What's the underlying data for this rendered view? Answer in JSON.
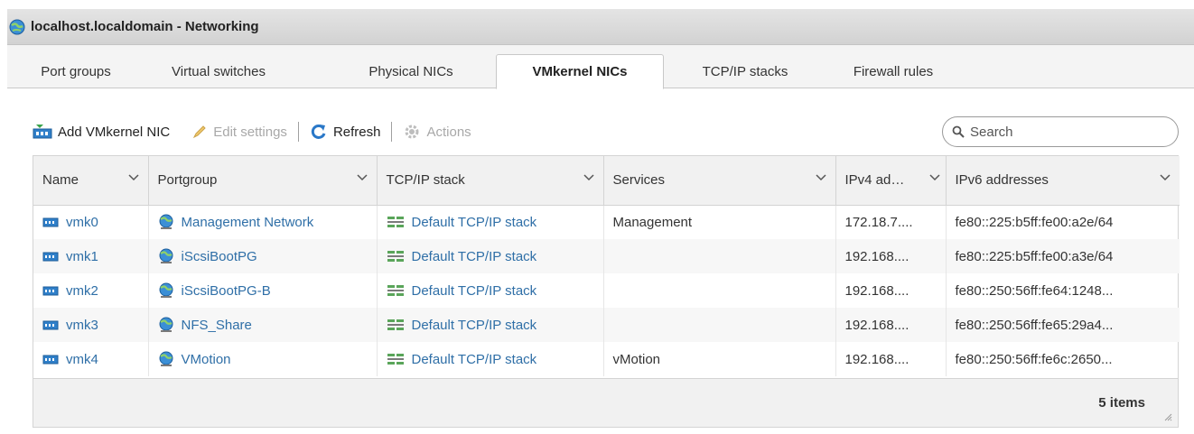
{
  "window": {
    "title": "localhost.localdomain - Networking"
  },
  "tabs": [
    {
      "label": "Port groups",
      "active": false
    },
    {
      "label": "Virtual switches",
      "active": false
    },
    {
      "label": "Physical NICs",
      "active": false
    },
    {
      "label": "VMkernel NICs",
      "active": true
    },
    {
      "label": "TCP/IP stacks",
      "active": false
    },
    {
      "label": "Firewall rules",
      "active": false
    }
  ],
  "toolbar": {
    "add_label": "Add VMkernel NIC",
    "edit_label": "Edit settings",
    "refresh_label": "Refresh",
    "actions_label": "Actions"
  },
  "search": {
    "placeholder": "Search"
  },
  "table": {
    "columns": [
      "Name",
      "Portgroup",
      "TCP/IP stack",
      "Services",
      "IPv4 ad…",
      "IPv6 addresses"
    ],
    "rows": [
      {
        "name": "vmk0",
        "portgroup": "Management Network",
        "stack": "Default TCP/IP stack",
        "services": "Management",
        "ipv4": "172.18.7....",
        "ipv6": "fe80::225:b5ff:fe00:a2e/64"
      },
      {
        "name": "vmk1",
        "portgroup": "iScsiBootPG",
        "stack": "Default TCP/IP stack",
        "services": "",
        "ipv4": "192.168....",
        "ipv6": "fe80::225:b5ff:fe00:a3e/64"
      },
      {
        "name": "vmk2",
        "portgroup": "iScsiBootPG-B",
        "stack": "Default TCP/IP stack",
        "services": "",
        "ipv4": "192.168....",
        "ipv6": "fe80::250:56ff:fe64:1248..."
      },
      {
        "name": "vmk3",
        "portgroup": "NFS_Share",
        "stack": "Default TCP/IP stack",
        "services": "",
        "ipv4": "192.168....",
        "ipv6": "fe80::250:56ff:fe65:29a4..."
      },
      {
        "name": "vmk4",
        "portgroup": "VMotion",
        "stack": "Default TCP/IP stack",
        "services": "vMotion",
        "ipv4": "192.168....",
        "ipv6": "fe80::250:56ff:fe6c:2650..."
      }
    ],
    "footer": "5 items"
  },
  "colors": {
    "link": "#2f6fa7",
    "refresh": "#2a78c8",
    "header_bg": "#f1f1f1"
  },
  "icons": [
    "globe-icon",
    "vmkernel-nic-icon",
    "pencil-icon",
    "refresh-icon",
    "gear-icon",
    "search-icon",
    "chevron-down-icon",
    "nic-icon",
    "portgroup-icon",
    "tcpip-stack-icon",
    "resize-grip-icon"
  ]
}
